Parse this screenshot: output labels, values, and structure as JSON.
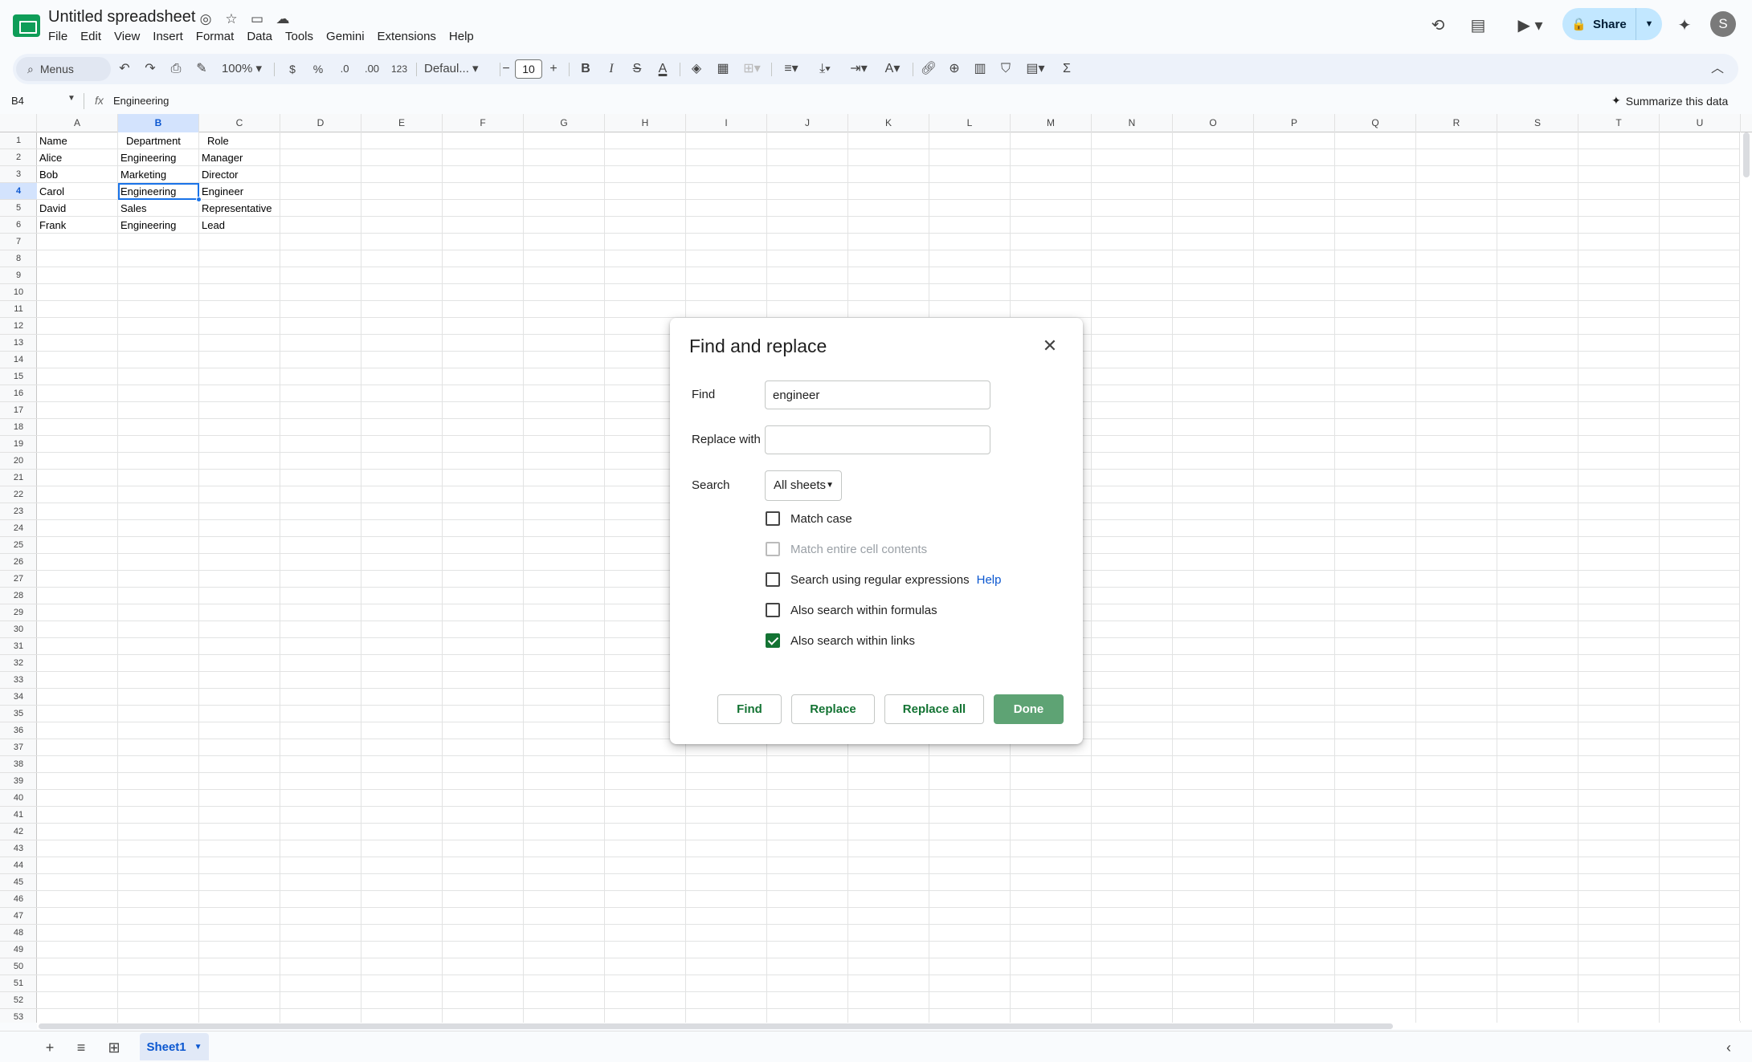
{
  "app": {
    "doc_title": "Untitled spreadsheet",
    "menus": [
      "File",
      "Edit",
      "View",
      "Insert",
      "Format",
      "Data",
      "Tools",
      "Gemini",
      "Extensions",
      "Help"
    ],
    "share_label": "Share",
    "avatar_initial": "S"
  },
  "toolbar": {
    "menus_search": "Menus",
    "zoom": "100%",
    "currency": "$",
    "percent": "%",
    "dec_decrease": ".0",
    "dec_increase": ".00",
    "number_format": "123",
    "font": "Defaul...",
    "font_size": "10"
  },
  "formula_bar": {
    "name_box": "B4",
    "value": "Engineering",
    "summarize": "Summarize this data"
  },
  "grid": {
    "columns": [
      "A",
      "B",
      "C",
      "D",
      "E",
      "F",
      "G",
      "H",
      "I",
      "J",
      "K",
      "L",
      "M",
      "N",
      "O",
      "P",
      "Q",
      "R",
      "S",
      "T",
      "U"
    ],
    "selected_column": "B",
    "row_count": 53,
    "selected_row": 4,
    "cells": [
      [
        "Name",
        "Department",
        "Role"
      ],
      [
        "Alice",
        "Engineering",
        "Manager"
      ],
      [
        "Bob",
        "Marketing",
        "Director"
      ],
      [
        "Carol",
        "Engineering",
        "Engineer"
      ],
      [
        "David",
        "Sales",
        "Representative"
      ],
      [
        "Frank",
        "Engineering",
        "Lead"
      ]
    ]
  },
  "sheets": {
    "active": "Sheet1"
  },
  "dialog": {
    "title": "Find and replace",
    "find_label": "Find",
    "find_value": "engineer",
    "replace_label": "Replace with",
    "replace_value": "",
    "search_label": "Search",
    "search_scope": "All sheets",
    "options": [
      {
        "label": "Match case",
        "checked": false,
        "disabled": false
      },
      {
        "label": "Match entire cell contents",
        "checked": false,
        "disabled": true
      },
      {
        "label": "Search using regular expressions",
        "checked": false,
        "disabled": false
      },
      {
        "label": "Also search within formulas",
        "checked": false,
        "disabled": false
      },
      {
        "label": "Also search within links",
        "checked": true,
        "disabled": false
      }
    ],
    "help_link": "Help",
    "buttons": {
      "find": "Find",
      "replace": "Replace",
      "replace_all": "Replace all",
      "done": "Done"
    }
  },
  "colors": {
    "accent_green": "#137333",
    "done_button": "#5ea374",
    "selection_blue": "#1a73e8",
    "share_bg": "#c2e7ff"
  }
}
